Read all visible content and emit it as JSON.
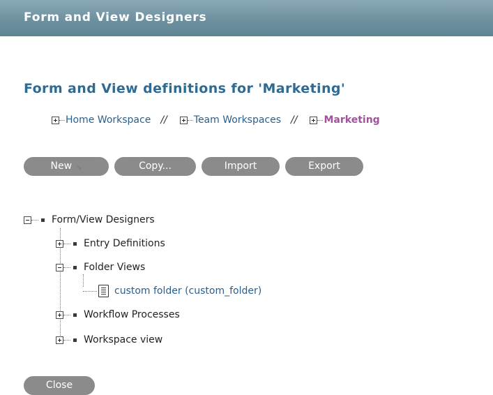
{
  "header": {
    "title": "Form and View Designers"
  },
  "page": {
    "title": "Form and View definitions for 'Marketing'"
  },
  "breadcrumb": {
    "items": [
      {
        "label": "Home Workspace"
      },
      {
        "label": "Team Workspaces"
      },
      {
        "label": "Marketing"
      }
    ],
    "separator": "//"
  },
  "buttons": {
    "new": "New",
    "copy": "Copy...",
    "import": "Import",
    "export": "Export"
  },
  "tree": {
    "root": "Form/View Designers",
    "entry_definitions": "Entry Definitions",
    "folder_views": "Folder Views",
    "custom_folder": "custom folder (custom_folder)",
    "workflow_processes": "Workflow Processes",
    "workspace_view": "Workspace view"
  },
  "footer": {
    "close": "Close"
  },
  "colors": {
    "header_bg": "#6e919f",
    "title_blue": "#2f6a93",
    "link_blue": "#2a5f8c",
    "current_purple": "#a0529a",
    "button_gray": "#8b8b8b"
  }
}
